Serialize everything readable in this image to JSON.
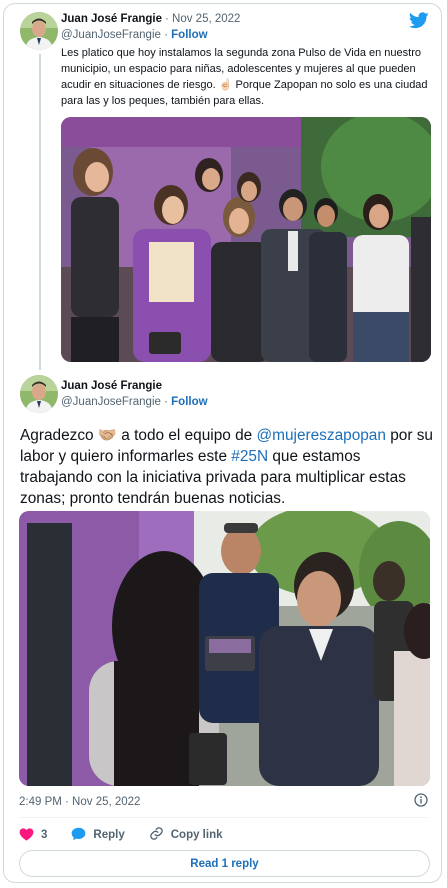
{
  "tweet1": {
    "author_name": "Juan José Frangie",
    "date": "· Nov 25, 2022",
    "handle": "@JuanJoseFrangie",
    "follow_label": "Follow",
    "text": "Les platico que hoy instalamos la segunda zona Pulso de Vida en nuestro municipio, un espacio para niñas, adolescentes y mujeres al que pueden acudir en situaciones de riesgo. ☝🏻 Porque Zapopan no solo es una ciudad para las y los peques, también para ellas."
  },
  "tweet2": {
    "author_name": "Juan José Frangie",
    "handle": "@JuanJoseFrangie",
    "separator": "·",
    "follow_label": "Follow",
    "text_before": "Agradezco 🤝🏼 a todo el equipo de ",
    "mention": "@mujereszapopan",
    "text_middle": " por su labor y quiero informarles este ",
    "hashtag": "#25N",
    "text_after": " que estamos trabajando con la iniciativa privada para multiplicar estas zonas; pronto tendrán buenas noticias.",
    "timestamp": "2:49 PM · Nov 25, 2022"
  },
  "actions": {
    "like_count": "3",
    "reply_label": "Reply",
    "copy_link_label": "Copy link"
  },
  "read_replies_label": "Read 1 reply",
  "icons": {
    "brand": "twitter-bird-icon",
    "like": "heart-icon",
    "reply": "speech-bubble-icon",
    "copy": "link-icon",
    "info": "info-icon"
  },
  "colors": {
    "brand": "#1d9bf0",
    "like": "#f91880",
    "link": "#1d6fb8",
    "muted": "#536471"
  }
}
